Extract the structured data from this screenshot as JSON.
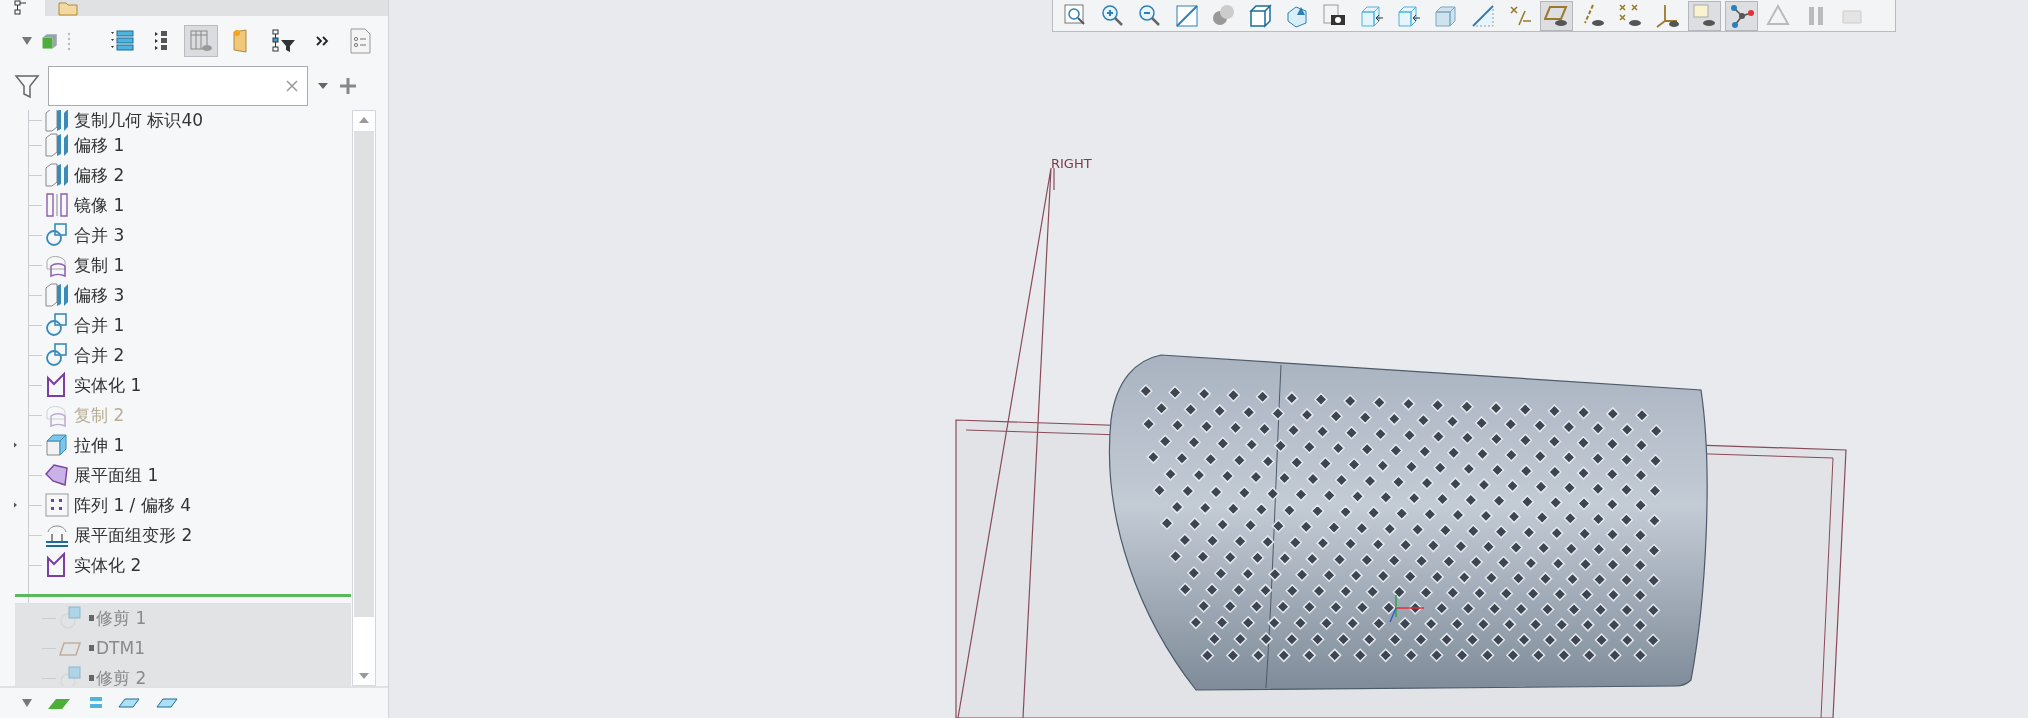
{
  "panel_tabs": [
    {
      "kind": "model-tree",
      "selected": true
    },
    {
      "kind": "folder",
      "selected": false
    }
  ],
  "tree_toolbar": [
    {
      "kind": "list",
      "selected": false
    },
    {
      "kind": "expand",
      "selected": false
    },
    {
      "kind": "columns",
      "selected": true
    },
    {
      "kind": "folder-new",
      "selected": false
    },
    {
      "kind": "tree-filter",
      "selected": false
    },
    {
      "kind": "more",
      "selected": false
    },
    {
      "kind": "settings-doc",
      "selected": false
    }
  ],
  "features": [
    {
      "label": "复制几何 标识40",
      "kind": "copy-geom",
      "disabled": false,
      "expandable": false
    },
    {
      "label": "偏移 1",
      "kind": "offset",
      "disabled": false,
      "expandable": false
    },
    {
      "label": "偏移 2",
      "kind": "offset",
      "disabled": false,
      "expandable": false
    },
    {
      "label": "镜像 1",
      "kind": "mirror",
      "disabled": false,
      "expandable": false
    },
    {
      "label": "合并 3",
      "kind": "merge",
      "disabled": false,
      "expandable": false
    },
    {
      "label": "复制 1",
      "kind": "copy",
      "disabled": false,
      "expandable": false
    },
    {
      "label": "偏移 3",
      "kind": "offset",
      "disabled": false,
      "expandable": false
    },
    {
      "label": "合并 1",
      "kind": "merge",
      "disabled": false,
      "expandable": false
    },
    {
      "label": "合并 2",
      "kind": "merge",
      "disabled": false,
      "expandable": false
    },
    {
      "label": "实体化 1",
      "kind": "solidify",
      "disabled": false,
      "expandable": false
    },
    {
      "label": "复制 2",
      "kind": "copy",
      "disabled": true,
      "expandable": false
    },
    {
      "label": "拉伸 1",
      "kind": "extrude",
      "disabled": false,
      "expandable": true
    },
    {
      "label": "展平面组 1",
      "kind": "flatten",
      "disabled": false,
      "expandable": false
    },
    {
      "label": "阵列 1 / 偏移 4",
      "kind": "pattern",
      "disabled": false,
      "expandable": true
    },
    {
      "label": "展平面组变形 2",
      "kind": "flatten-deform",
      "disabled": false,
      "expandable": false
    },
    {
      "label": "实体化 2",
      "kind": "solidify",
      "disabled": false,
      "expandable": false
    }
  ],
  "after_insert": [
    {
      "label": "修剪 1",
      "kind": "trim"
    },
    {
      "label": "DTM1",
      "kind": "datum-plane"
    },
    {
      "label": "修剪 2",
      "kind": "trim"
    }
  ],
  "view_toolbar": [
    {
      "kind": "refit",
      "selected": false
    },
    {
      "kind": "zoom-in",
      "selected": false
    },
    {
      "kind": "zoom-out",
      "selected": false
    },
    {
      "kind": "repaint",
      "selected": false
    },
    {
      "kind": "display-style",
      "selected": false
    },
    {
      "kind": "saved-views",
      "selected": false
    },
    {
      "kind": "view-manager",
      "selected": false
    },
    {
      "kind": "snapshot",
      "selected": false
    },
    {
      "kind": "view-back",
      "selected": false
    },
    {
      "kind": "view-front",
      "selected": false
    },
    {
      "kind": "perspective",
      "selected": false
    },
    {
      "kind": "section",
      "selected": false
    },
    {
      "kind": "annotation",
      "selected": false
    },
    {
      "kind": "plane-display",
      "selected": true
    },
    {
      "kind": "axis-display",
      "selected": false
    },
    {
      "kind": "point-display",
      "selected": false
    },
    {
      "kind": "csys-display",
      "selected": false
    },
    {
      "kind": "tag-display",
      "selected": true
    },
    {
      "kind": "spin-center",
      "selected": true
    },
    {
      "kind": "play",
      "selected": false
    },
    {
      "kind": "pause",
      "selected": false
    },
    {
      "kind": "stop",
      "selected": false
    }
  ],
  "viewport": {
    "plane_label": "RIGHT"
  }
}
